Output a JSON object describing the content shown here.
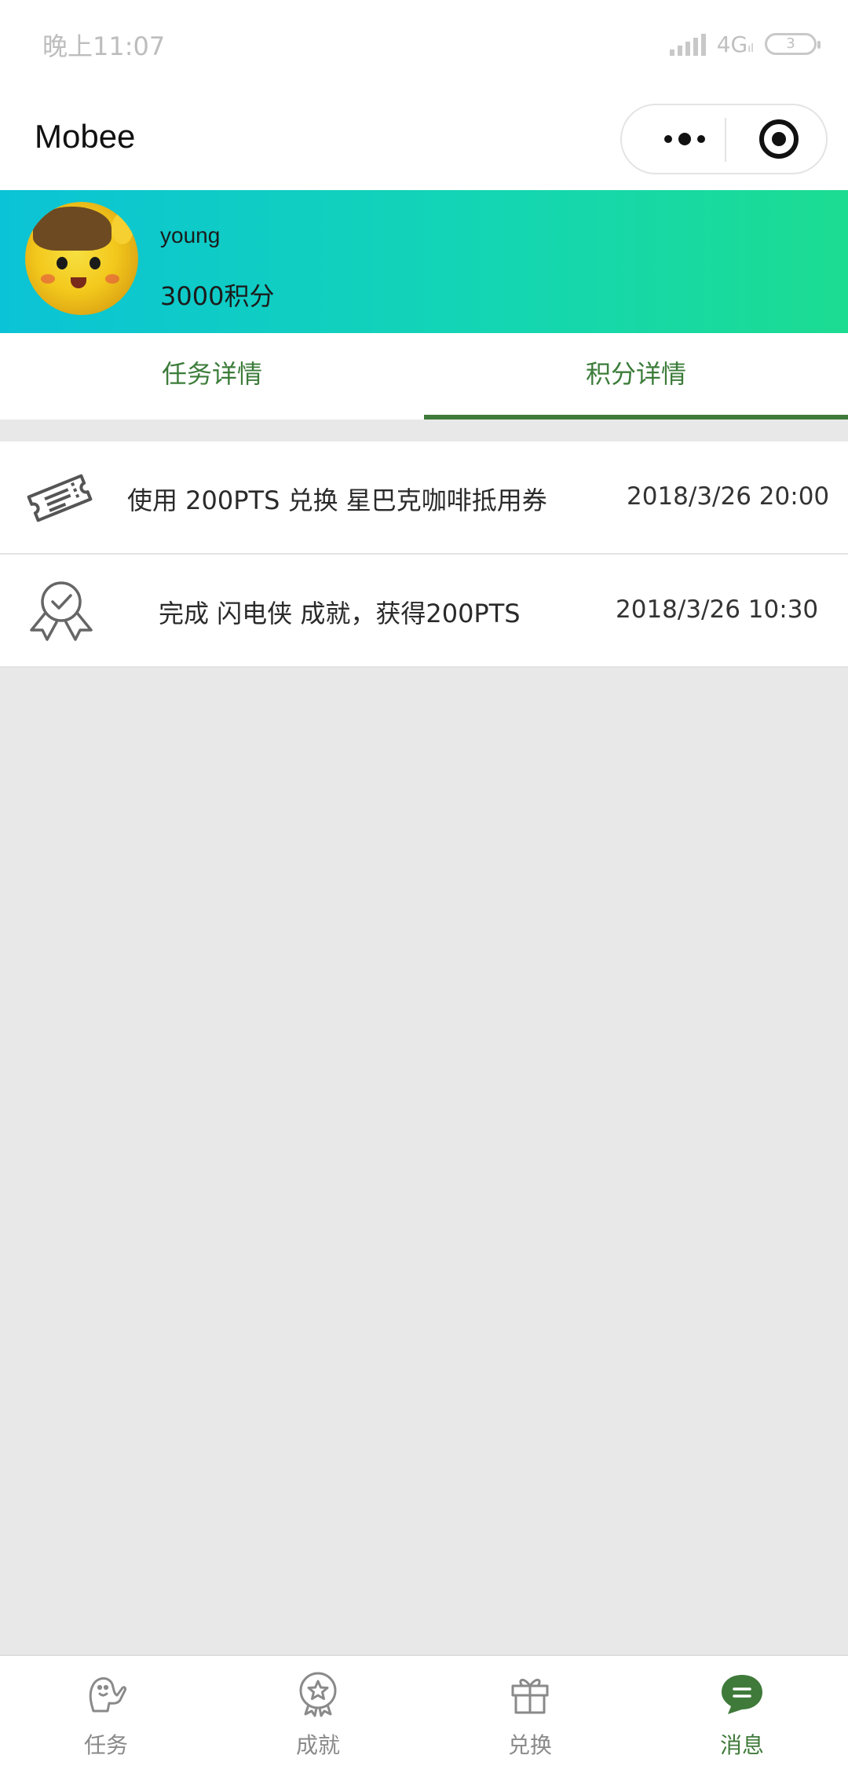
{
  "status_bar": {
    "time": "晚上11:07",
    "network": "4G",
    "battery": "3"
  },
  "nav": {
    "title": "Mobee"
  },
  "profile": {
    "name": "young",
    "points": "3000积分"
  },
  "tabs": [
    {
      "label": "任务详情",
      "active": false
    },
    {
      "label": "积分详情",
      "active": true
    }
  ],
  "records": [
    {
      "icon": "ticket-icon",
      "text": "使用 200PTS 兑换 星巴克咖啡抵用券",
      "time": "2018/3/26 20:00"
    },
    {
      "icon": "badge-check-icon",
      "text": "完成 闪电侠 成就，获得200PTS",
      "time": "2018/3/26 10:30"
    }
  ],
  "tabbar": [
    {
      "label": "任务",
      "icon": "mascot-icon",
      "active": false
    },
    {
      "label": "成就",
      "icon": "medal-icon",
      "active": false
    },
    {
      "label": "兑换",
      "icon": "gift-icon",
      "active": false
    },
    {
      "label": "消息",
      "icon": "message-icon",
      "active": true
    }
  ],
  "colors": {
    "accent_green": "#3f7a3a",
    "banner_start": "#0bc3d6",
    "banner_end": "#1cdc92",
    "background": "#e9e8e9"
  }
}
